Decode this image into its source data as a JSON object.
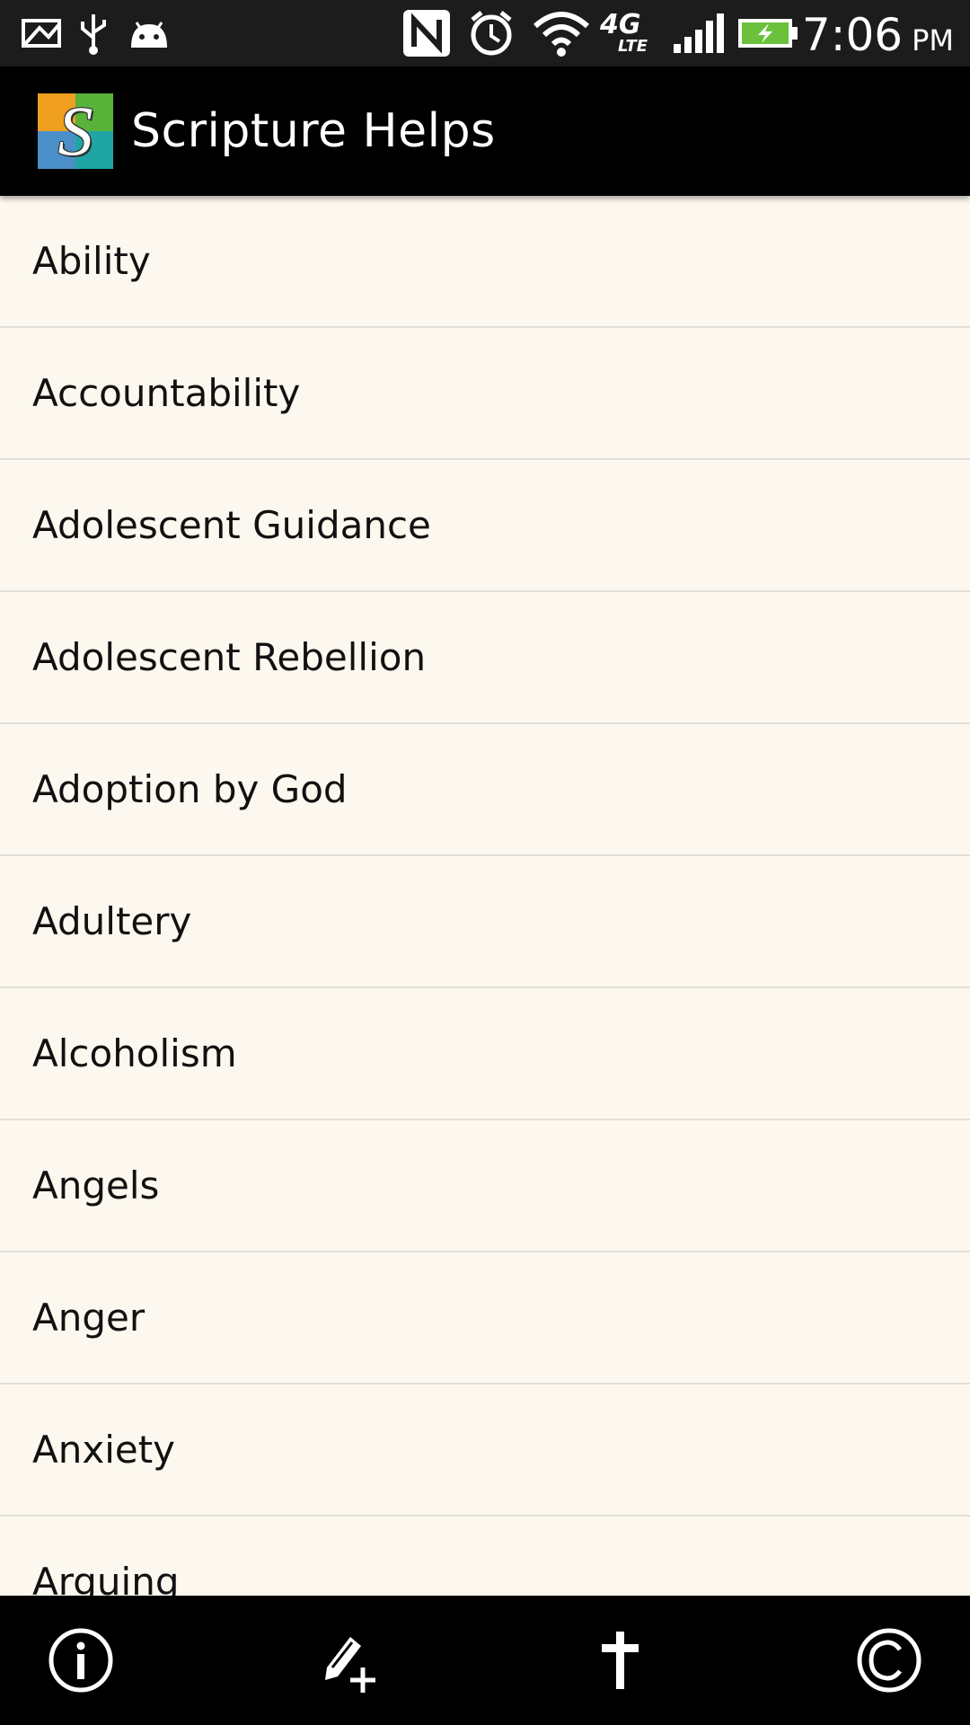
{
  "status_bar": {
    "time": "7:06",
    "ampm": "PM",
    "left_icons": [
      "image-icon",
      "usb-icon",
      "android-icon"
    ],
    "right_icons": [
      "nfc-icon",
      "alarm-icon",
      "wifi-icon",
      "4g-lte-icon",
      "signal-icon",
      "battery-charging-icon"
    ],
    "network_label": "4G",
    "network_sub": "LTE"
  },
  "action_bar": {
    "title": "Scripture Helps",
    "logo_letter": "S"
  },
  "topics": [
    "Ability",
    "Accountability",
    "Adolescent Guidance",
    "Adolescent Rebellion",
    "Adoption by God",
    "Adultery",
    "Alcoholism",
    "Angels",
    "Anger",
    "Anxiety",
    "Arguing"
  ],
  "bottom_bar": {
    "buttons": [
      "info-icon",
      "add-note-icon",
      "cross-icon",
      "copyright-icon"
    ]
  },
  "colors": {
    "list_background": "#fdf8ef",
    "divider": "#e2dfd8",
    "bar_background": "#000000",
    "battery_green": "#6ac13b"
  }
}
